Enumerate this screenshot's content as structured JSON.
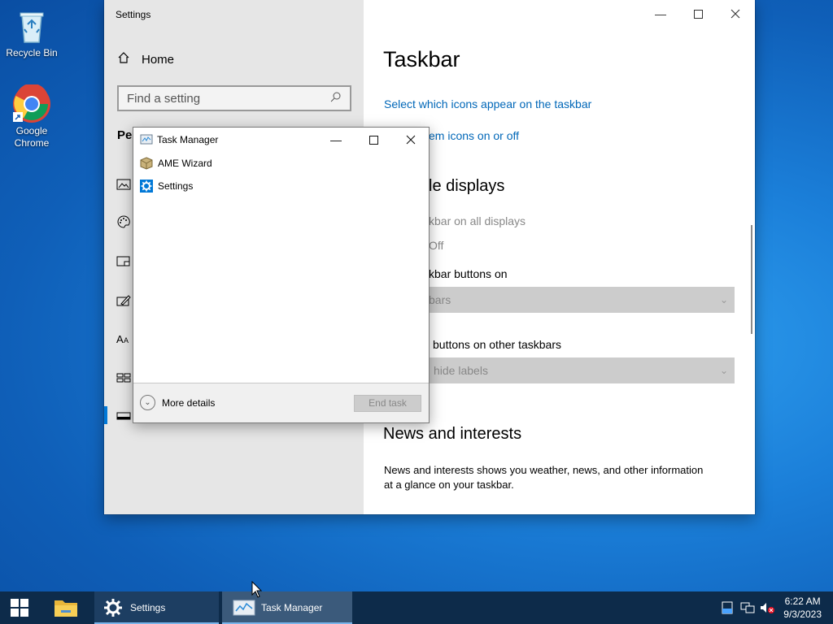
{
  "desktop": {
    "icons": [
      {
        "label": "Recycle Bin"
      },
      {
        "label": "Google Chrome"
      }
    ]
  },
  "settings": {
    "window_title": "Settings",
    "home_label": "Home",
    "search_placeholder": "Find a setting",
    "section_label": "Per",
    "page_title": "Taskbar",
    "link_icons": "Select which icons appear on the taskbar",
    "link_system_icons": "em icons on or off",
    "multiple_displays_heading": "le displays",
    "show_all_displays": "kbar on all displays",
    "toggle_state": "Off",
    "show_buttons_on": "kbar buttons on",
    "dropdown_1_value": "bars",
    "combine_other": "buttons on other taskbars",
    "dropdown_2_value": "hide labels",
    "news_heading": "News and interests",
    "news_desc_1": "News and interests shows you weather, news, and other information",
    "news_desc_2": "at a glance on your taskbar."
  },
  "task_manager": {
    "title": "Task Manager",
    "apps": [
      {
        "name": "AME Wizard"
      },
      {
        "name": "Settings"
      }
    ],
    "more_details": "More details",
    "end_task": "End task"
  },
  "taskbar": {
    "settings_label": "Settings",
    "taskmgr_label": "Task Manager",
    "time": "6:22 AM",
    "date": "9/3/2023"
  },
  "colors": {
    "accent": "#0078d7",
    "link": "#0067b8",
    "taskbar": "#0d2b4a"
  }
}
